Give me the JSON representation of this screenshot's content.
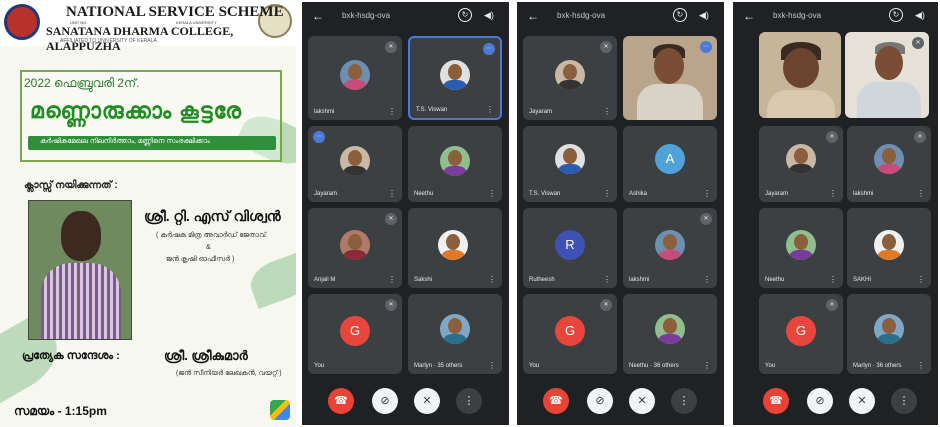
{
  "poster": {
    "title_en": "NATIONAL SERVICE SCHEME",
    "title_tag_left": "UNIT NO.",
    "title_tag_right": "KERALA UNIVERSITY",
    "college": "SANATANA DHARMA COLLEGE, ALAPPUZHA",
    "affiliation": "AFFILIATED TO UNIVERSITY OF KERALA",
    "date": "2022 ഫെബ്രുവരി 2ന്.",
    "event_title": "മണ്ണൊരുക്കാം കൂട്ടരേ",
    "subtitle": "കർഷികമേഖല നിലനിർത്താം, മണ്ണിനെ സംരക്ഷിക്കാം",
    "class_by_label": "ക്ലാസ്സ് നയിക്കുന്നത് :",
    "speaker": "ശ്രീ. റ്റി. എസ് വിശ്വൻ",
    "speaker_award": "( കർഷക മിത്ര അവാർഡ് ജേതാവ്",
    "speaker_amp": "&",
    "speaker_role": "ജൻ കൃഷി ഓഫീസർ )",
    "special_label": "പ്രത്യേക സന്ദേശം  :",
    "guest": "ശ്രീ. ശ്രീകുമാർ",
    "guest_role": "(ജൻ സീനിയർ ലേഖകൻ, വയറ്റ് )",
    "time": "സമയം - 1:15pm"
  },
  "meet": {
    "meeting_code": "bxk-hsdg-ova",
    "back_icon": "arrow-left-icon",
    "camera_switch_icon": "camera-switch-icon",
    "speaker_icon": "speaker-icon",
    "end_call_icon": "phone-hangup-icon",
    "camera_off_icon": "camera-off-icon",
    "mic_off_icon": "mic-off-icon",
    "more_icon": "more-vert-icon",
    "panel1": [
      "lakshmi",
      "T.S. Viswan",
      "Jayaram",
      "Neethu",
      "Anjali M",
      "Sakshi",
      "You",
      "Marlyn · 35 others"
    ],
    "panel2": [
      "Jayaram",
      "T.S. Viswan",
      "Ashika",
      "Rutheesh",
      "lakshmi",
      "You",
      "Neethu · 36 others"
    ],
    "panel3": [
      "Jayaram",
      "lakshmi",
      "Neethu",
      "SAKHI",
      "You",
      "Marlyn · 36 others"
    ],
    "colors": {
      "bg": "#202124",
      "tile": "#3c4043",
      "end": "#ea4335",
      "highlight": "#4a7ad8"
    }
  }
}
